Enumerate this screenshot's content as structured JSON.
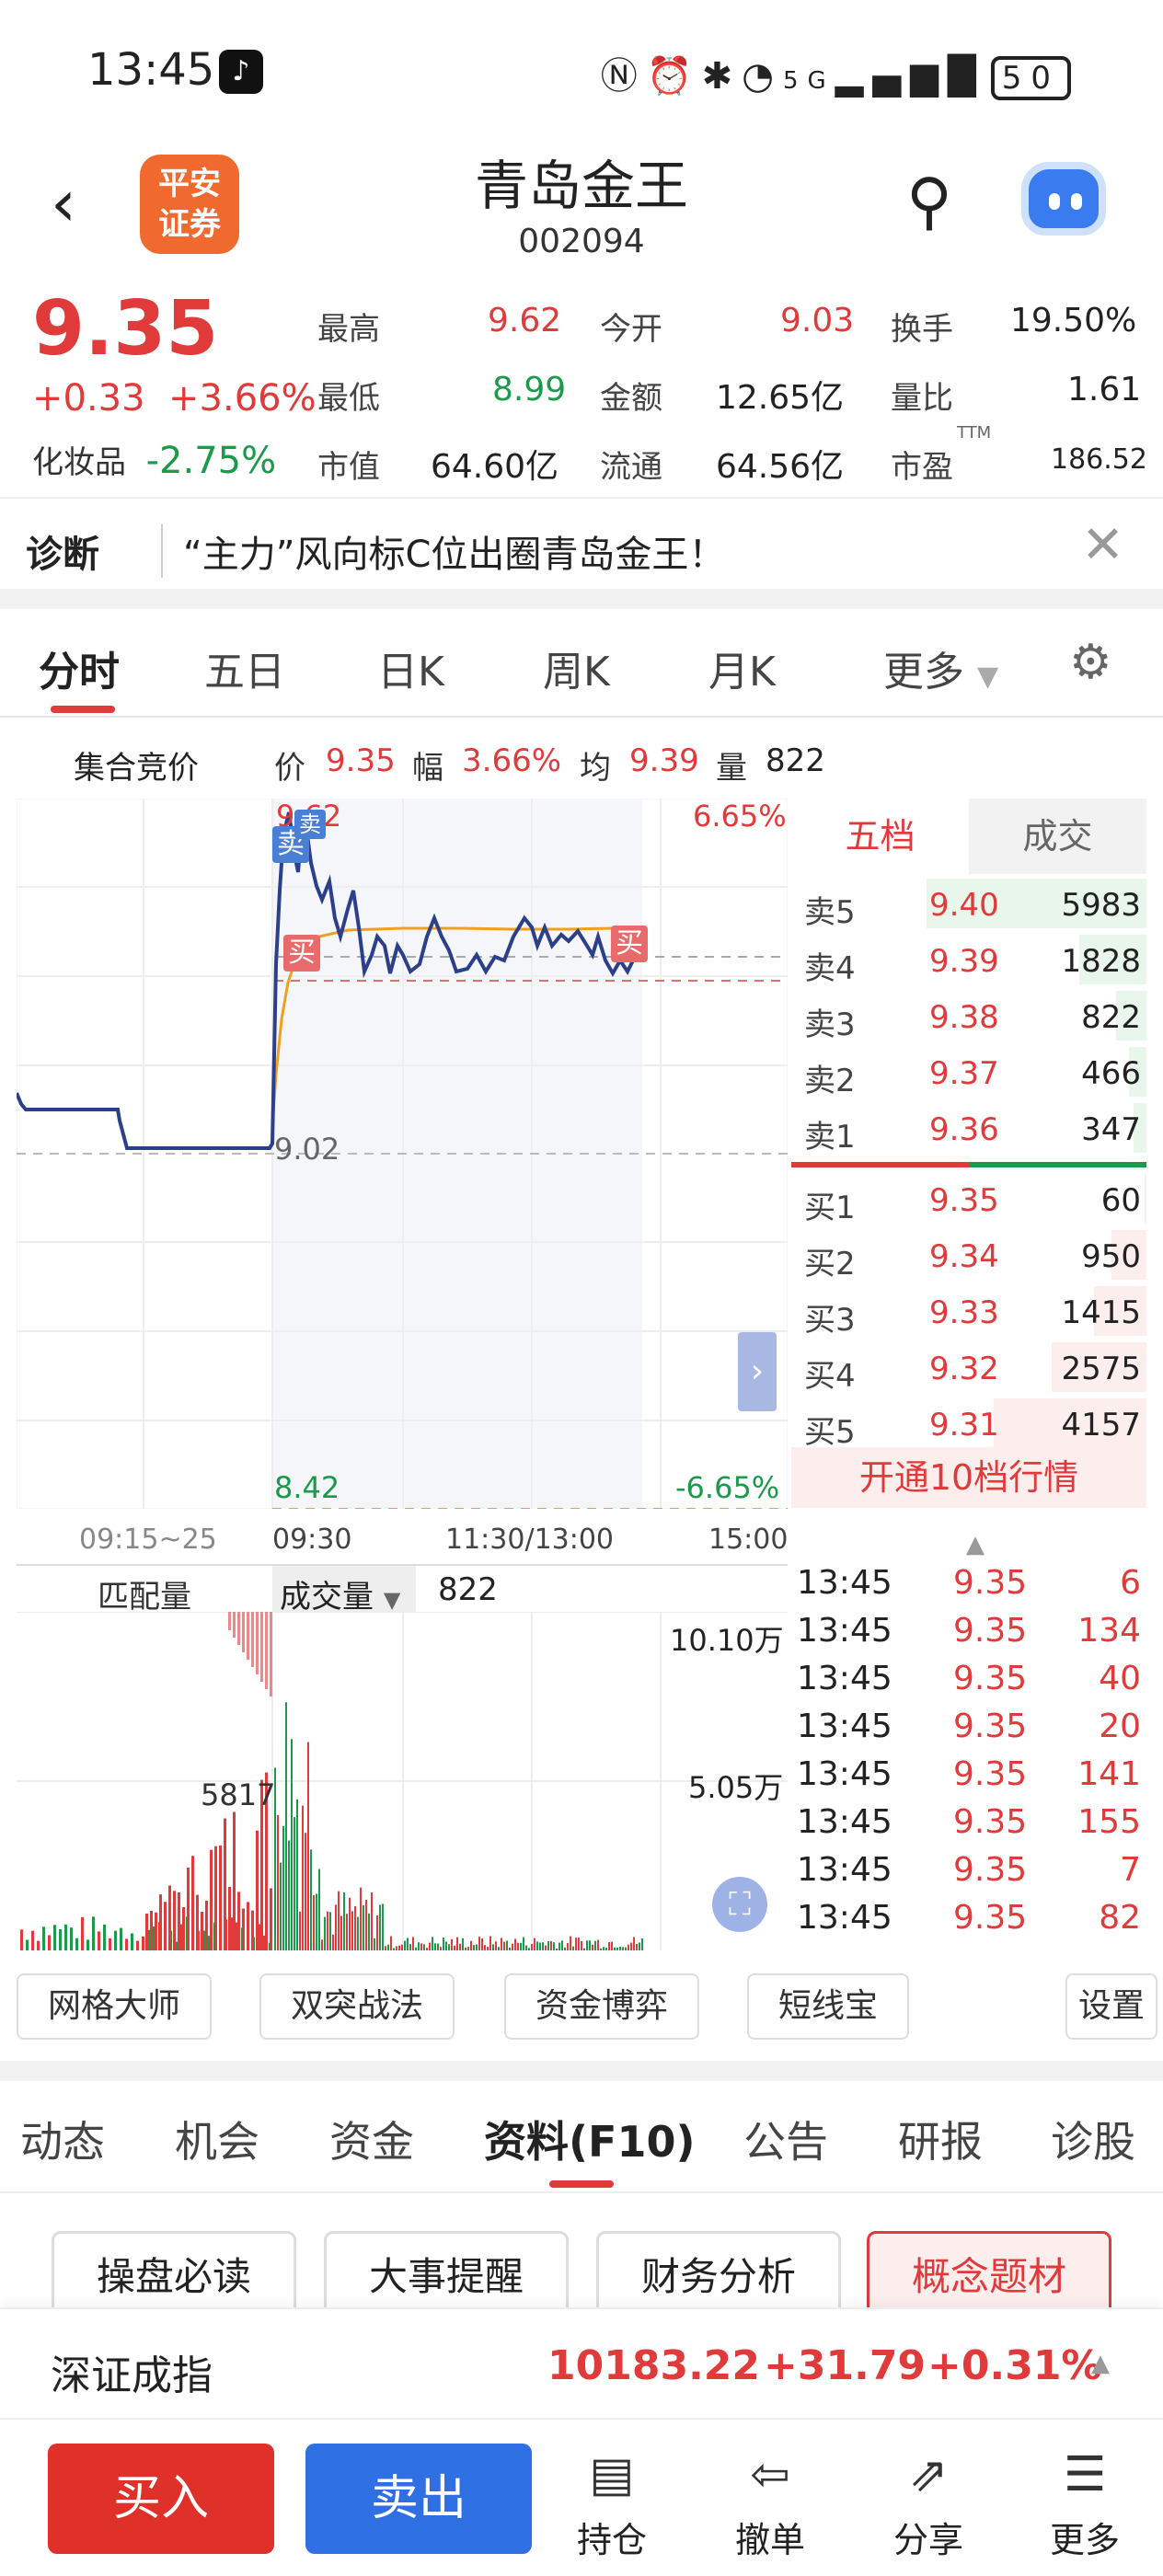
{
  "status": {
    "time": "13:45",
    "battery": "50",
    "network": "5G"
  },
  "header": {
    "logo_line1": "平安",
    "logo_line2": "证券",
    "title": "青岛金王",
    "code": "002094"
  },
  "quote": {
    "price": "9.35",
    "change": "+0.33",
    "change_pct": "+3.66%",
    "sector_name": "化妆品",
    "sector_pct": "-2.75%",
    "high_label": "最高",
    "high": "9.62",
    "open_label": "今开",
    "open": "9.03",
    "turnover_label": "换手",
    "turnover": "19.50%",
    "low_label": "最低",
    "low": "8.99",
    "amount_label": "金额",
    "amount": "12.65亿",
    "volratio_label": "量比",
    "volratio": "1.61",
    "mktcap_label": "市值",
    "mktcap": "64.60亿",
    "float_label": "流通",
    "float": "64.56亿",
    "pe_label": "市盈",
    "pe_sup": "TTM",
    "pe": "186.52"
  },
  "diagnosis": {
    "tag": "诊断",
    "text": "“主力”风向标C位出圈青岛金王！"
  },
  "chart_tabs": [
    "分时",
    "五日",
    "日K",
    "周K",
    "月K",
    "更多"
  ],
  "info_line": {
    "auction": "集合竞价",
    "price_label": "价",
    "price": "9.35",
    "amp_label": "幅",
    "amp": "3.66%",
    "avg_label": "均",
    "avg": "9.39",
    "vol_label": "量",
    "vol": "822"
  },
  "chart_labels": {
    "top_price": "9.62",
    "top_pct": "6.65%",
    "mid_price": "9.02",
    "bottom_price": "8.42",
    "bottom_pct": "-6.65%",
    "sell_mark": "卖",
    "buy_mark": "买"
  },
  "time_axis": [
    "09:15~25",
    "09:30",
    "11:30/13:00",
    "15:00"
  ],
  "order_book": {
    "tabs": [
      "五档",
      "成交"
    ],
    "asks": [
      {
        "label": "卖5",
        "price": "9.40",
        "vol": "5983"
      },
      {
        "label": "卖4",
        "price": "9.39",
        "vol": "1828"
      },
      {
        "label": "卖3",
        "price": "9.38",
        "vol": "822"
      },
      {
        "label": "卖2",
        "price": "9.37",
        "vol": "466"
      },
      {
        "label": "卖1",
        "price": "9.36",
        "vol": "347"
      }
    ],
    "bids": [
      {
        "label": "买1",
        "price": "9.35",
        "vol": "60"
      },
      {
        "label": "买2",
        "price": "9.34",
        "vol": "950"
      },
      {
        "label": "买3",
        "price": "9.33",
        "vol": "1415"
      },
      {
        "label": "买4",
        "price": "9.32",
        "vol": "2575"
      },
      {
        "label": "买5",
        "price": "9.31",
        "vol": "4157"
      }
    ],
    "open_level10": "开通10档行情"
  },
  "volume_panel": {
    "match_label": "匹配量",
    "vol_label": "成交量",
    "vol_value": "822",
    "max": "10.10万",
    "mid": "5.05万",
    "auction_vol": "5817"
  },
  "ticks": [
    {
      "time": "13:45",
      "price": "9.35",
      "vol": "6"
    },
    {
      "time": "13:45",
      "price": "9.35",
      "vol": "134"
    },
    {
      "time": "13:45",
      "price": "9.35",
      "vol": "40"
    },
    {
      "time": "13:45",
      "price": "9.35",
      "vol": "20"
    },
    {
      "time": "13:45",
      "price": "9.35",
      "vol": "141"
    },
    {
      "time": "13:45",
      "price": "9.35",
      "vol": "155"
    },
    {
      "time": "13:45",
      "price": "9.35",
      "vol": "7"
    },
    {
      "time": "13:45",
      "price": "9.35",
      "vol": "82"
    }
  ],
  "tools": [
    "网格大师",
    "双突战法",
    "资金博弈",
    "短线宝",
    "设置"
  ],
  "sub_tabs": [
    "动态",
    "机会",
    "资金",
    "资料(F10)",
    "公告",
    "研报",
    "诊股"
  ],
  "cards": [
    "操盘必读",
    "大事提醒",
    "财务分析",
    "概念题材"
  ],
  "index_bar": {
    "name": "深证成指",
    "value": "10183.22",
    "change": "+31.79",
    "pct": "+0.31%"
  },
  "bottom": {
    "buy": "买入",
    "sell": "卖出",
    "actions": [
      "持仓",
      "撤单",
      "分享",
      "更多"
    ]
  },
  "colors": {
    "up": "#e03a3a",
    "down": "#1a9a4a",
    "price_line": "#2b3f8a",
    "avg_line": "#f0a020",
    "buy_btn": "#e0302a",
    "sell_btn": "#2f6fe4"
  }
}
